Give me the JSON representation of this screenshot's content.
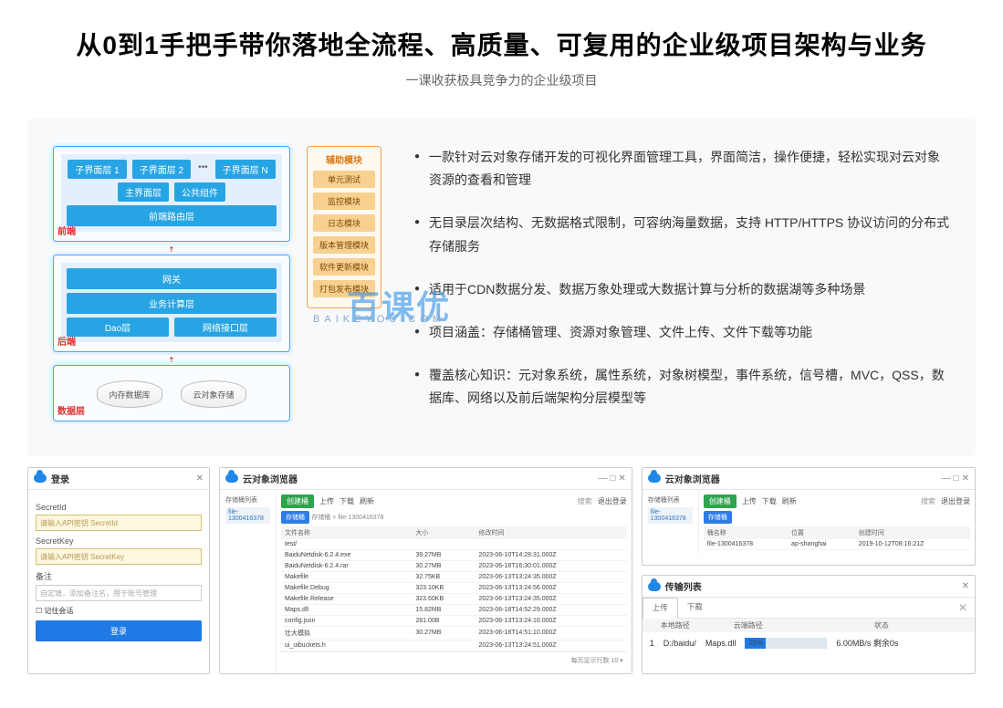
{
  "header": {
    "title": "从0到1手把手带你落地全流程、高质量、可复用的企业级项目架构与业务",
    "subtitle": "一课收获极具竞争力的企业级项目"
  },
  "arch": {
    "frontend": {
      "label": "前端",
      "row1": [
        "子界面层 1",
        "子界面层 2",
        "子界面层 N"
      ],
      "row2": [
        "主界面层",
        "公共组件"
      ],
      "band": "前端路由层"
    },
    "backend": {
      "label": "后端",
      "gateway": "网关",
      "biz": "业务计算层",
      "cols": [
        "Dao层",
        "网络接口层"
      ]
    },
    "data": {
      "label": "数据层",
      "items": [
        "内存数据库",
        "云对象存储"
      ]
    },
    "aux": {
      "title": "辅助模块",
      "items": [
        "单元测试",
        "监控模块",
        "日志模块",
        "版本管理模块",
        "软件更新模块",
        "打包发布模块"
      ]
    }
  },
  "bullets": [
    "一款针对云对象存储开发的可视化界面管理工具，界面简洁，操作便捷，轻松实现对云对象资源的查看和管理",
    "无目录层次结构、无数据格式限制，可容纳海量数据，支持 HTTP/HTTPS 协议访问的分布式存储服务",
    "适用于CDN数据分发、数据万象处理或大数据计算与分析的数据湖等多种场景",
    "项目涵盖：存储桶管理、资源对象管理、文件上传、文件下载等功能",
    "覆盖核心知识：元对象系统，属性系统，对象树模型，事件系统，信号槽，MVC，QSS，数据库、网络以及前后端架构分层模型等"
  ],
  "watermark": {
    "big": "百课优",
    "small": "BAIKEYOU.COM"
  },
  "login": {
    "title": "登录",
    "close": "✕",
    "secretid_label": "SecretId",
    "secretid_ph": "请输入API密钥 SecretId",
    "secretkey_label": "SecretKey",
    "secretkey_ph": "请输入API密钥 SecretKey",
    "remark_label": "备注",
    "remark_ph": "自定填，添加备注名，用于账号管理",
    "remember": "记住会话",
    "btn": "登录"
  },
  "browser": {
    "title": "云对象浏览器",
    "win_ctrls": [
      "—",
      "□",
      "✕"
    ],
    "side_label": "存储桶列表",
    "side_item": "file-1300416378",
    "toolbar": {
      "create": "创建桶",
      "upload": "上传",
      "download": "下载",
      "refresh": "刷新",
      "search": "搜索",
      "logout": "退出登录"
    },
    "breadcrumb": "存储桶 > file-1300416378",
    "cols": [
      "文件名称",
      "大小",
      "修改时间"
    ],
    "rows": [
      {
        "n": "test/",
        "s": "",
        "t": ""
      },
      {
        "n": "BaiduNetdisk-6.2.4.exe",
        "s": "39.27MB",
        "t": "2023-06-10T14:28:31.000Z"
      },
      {
        "n": "BaiduNetdisk-6.2.4.rar",
        "s": "30.27MB",
        "t": "2023-06-18T16:30:01.000Z"
      },
      {
        "n": "Makefile",
        "s": "32.75KB",
        "t": "2023-06-13T13:24:35.000Z"
      },
      {
        "n": "Makefile.Debug",
        "s": "323.10KB",
        "t": "2023-06-13T13:24:56.000Z"
      },
      {
        "n": "Makefile.Release",
        "s": "323.60KB",
        "t": "2023-06-13T13:24:35.000Z"
      },
      {
        "n": "Maps.dll",
        "s": "15.82MB",
        "t": "2023-06-18T14:52:29.000Z"
      },
      {
        "n": "config.json",
        "s": "281.00B",
        "t": "2023-06-13T13:24:10.000Z"
      },
      {
        "n": "壮大模拟",
        "s": "30.27MB",
        "t": "2023-06-18T14:51:10.000Z"
      },
      {
        "n": "ui_uibuckets.h",
        "s": "",
        "t": "2023-06-13T13:24:51.000Z"
      }
    ],
    "pager": "每页显示行数 10"
  },
  "buckets": {
    "title": "云对象浏览器",
    "tag": "存储桶",
    "cols": [
      "桶名称",
      "位置",
      "创建时间"
    ],
    "row": {
      "n": "file-1300416378",
      "l": "ap-shanghai",
      "t": "2019-10-12T08:16:21Z"
    }
  },
  "transfer": {
    "title": "传输列表",
    "close": "✕",
    "tabs": [
      "上传",
      "下载"
    ],
    "cols": [
      "",
      "本地路径",
      "云端路径",
      "状态"
    ],
    "row": {
      "idx": "1",
      "local": "D:/baidu/",
      "cloud": "Maps.dll",
      "pct": "25%",
      "speed": "6.00MB/s 剩余0s"
    }
  }
}
